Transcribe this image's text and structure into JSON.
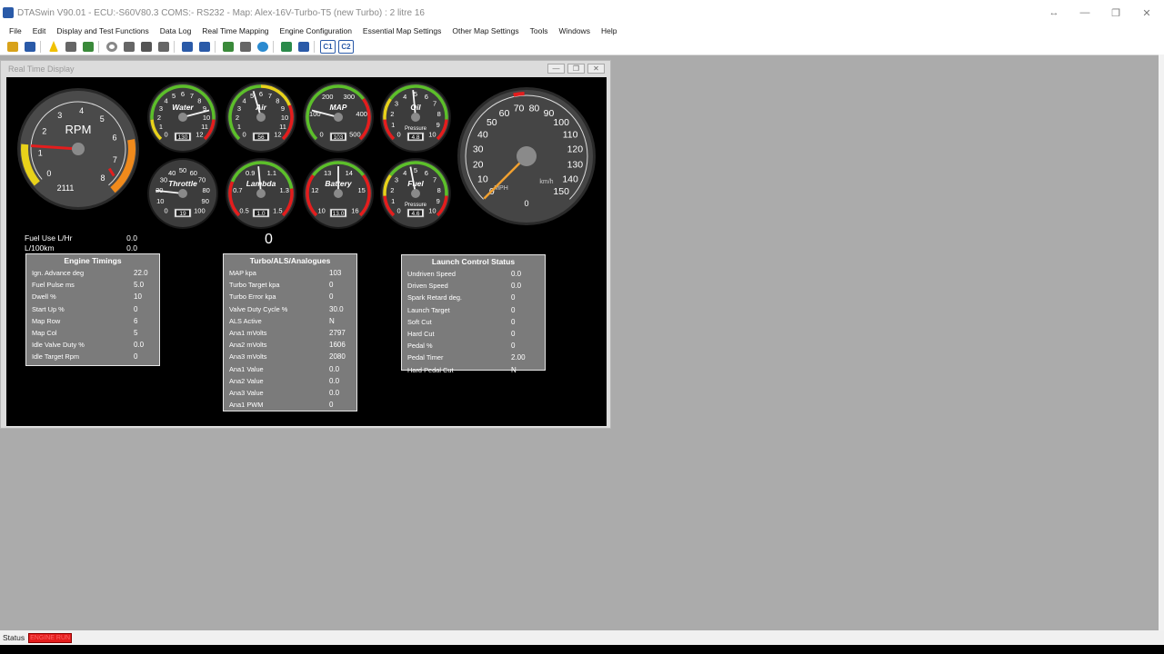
{
  "window": {
    "title": "DTASwin V90.01 - ECU:-S60V80.3 COMS:- RS232 - Map: Alex-16V-Turbo-T5 (new Turbo) : 2 litre 16",
    "resize_glyph": "↔",
    "min_glyph": "—",
    "max_glyph": "❐",
    "close_glyph": "✕"
  },
  "menu": [
    "File",
    "Edit",
    "Display and Test Functions",
    "Data Log",
    "Real Time Mapping",
    "Engine Configuration",
    "Essential Map Settings",
    "Other Map Settings",
    "Tools",
    "Windows",
    "Help"
  ],
  "toolbar": {
    "icons": [
      "open-folder-icon",
      "save-icon",
      "lightning-icon",
      "lock-icon",
      "chip-icon",
      "gear-icon",
      "pencil-icon",
      "wrench-icon",
      "turbo-icon",
      "ignition-icon",
      "s-icon",
      "chart-icon",
      "tools-icon",
      "globe-icon",
      "arrow-panel-icon",
      "grid-icon",
      "c1-icon",
      "c2-icon"
    ],
    "c1": "C1",
    "c2": "C2"
  },
  "child": {
    "title": "Real Time Display",
    "min": "—",
    "max": "❐",
    "close": "✕"
  },
  "gauges": {
    "rpm": {
      "label": "RPM",
      "value": "2111",
      "ticks": [
        "0",
        "1",
        "2",
        "3",
        "4",
        "5",
        "6",
        "7",
        "8"
      ],
      "reading": 1.3
    },
    "water": {
      "label": "Water",
      "value": "130",
      "ticks": [
        "0",
        "1",
        "2",
        "3",
        "4",
        "5",
        "6",
        "7",
        "8",
        "9",
        "10",
        "11",
        "12"
      ]
    },
    "air": {
      "label": "Air",
      "value": "56",
      "ticks": [
        "0",
        "1",
        "2",
        "3",
        "4",
        "5",
        "6",
        "7",
        "8",
        "9",
        "10",
        "11",
        "12"
      ]
    },
    "map": {
      "label": "MAP",
      "value": "103",
      "ticks": [
        "0",
        "100",
        "200",
        "300",
        "400",
        "500"
      ]
    },
    "oil": {
      "label": "Oil",
      "sub": "Pressure",
      "value": "4.8",
      "ticks": [
        "0",
        "1",
        "2",
        "3",
        "4",
        "5",
        "6",
        "7",
        "8",
        "9",
        "10"
      ]
    },
    "throttle": {
      "label": "Throttle",
      "value": "19",
      "ticks": [
        "0",
        "10",
        "20",
        "30",
        "40",
        "50",
        "60",
        "70",
        "80",
        "90",
        "100"
      ]
    },
    "lambda": {
      "label": "Lambda",
      "value": "1.0",
      "ticks": [
        "0.5",
        "0.7",
        "0.9",
        "1.1",
        "1.3",
        "1.5"
      ]
    },
    "battery": {
      "label": "Battery",
      "value": "13.0",
      "ticks": [
        "10",
        "12",
        "13",
        "14",
        "15",
        "16"
      ]
    },
    "fuel": {
      "label": "Fuel",
      "sub": "Pressure",
      "value": "4.6",
      "ticks": [
        "0",
        "1",
        "2",
        "3",
        "4",
        "5",
        "6",
        "7",
        "8",
        "9",
        "10"
      ]
    },
    "speed": {
      "label_mph": "MPH",
      "label_kmh": "km/h",
      "value": "0",
      "ticks": [
        "0",
        "10",
        "20",
        "30",
        "40",
        "50",
        "60",
        "70",
        "80",
        "90",
        "100",
        "110",
        "120",
        "130",
        "140",
        "150"
      ]
    }
  },
  "fuel_use": [
    {
      "label": "Fuel Use L/Hr",
      "value": "0.0"
    },
    {
      "label": "L/100km",
      "value": "0.0"
    }
  ],
  "center_value": "0",
  "engine_timings": {
    "title": "Engine Timings",
    "rows": [
      {
        "label": "Ign. Advance deg",
        "value": "22.0"
      },
      {
        "label": "Fuel Pulse ms",
        "value": "5.0"
      },
      {
        "label": "Dwell %",
        "value": "10"
      },
      {
        "label": "Start Up %",
        "value": "0"
      },
      {
        "label": "Map Row",
        "value": "6"
      },
      {
        "label": "Map Col",
        "value": "5"
      },
      {
        "label": "Idle Valve Duty %",
        "value": "0.0"
      },
      {
        "label": "Idle Target Rpm",
        "value": "0"
      }
    ]
  },
  "turbo": {
    "title": "Turbo/ALS/Analogues",
    "rows": [
      {
        "label": "MAP kpa",
        "value": "103"
      },
      {
        "label": "Turbo Target kpa",
        "value": "0"
      },
      {
        "label": "Turbo Error kpa",
        "value": "0"
      },
      {
        "label": "Valve Duty Cycle %",
        "value": "30.0"
      },
      {
        "label": "ALS Active",
        "value": "N"
      },
      {
        "label": "Ana1 mVolts",
        "value": "2797"
      },
      {
        "label": "Ana2 mVolts",
        "value": "1606"
      },
      {
        "label": "Ana3 mVolts",
        "value": "2080"
      },
      {
        "label": "Ana1 Value",
        "value": "0.0"
      },
      {
        "label": "Ana2 Value",
        "value": "0.0"
      },
      {
        "label": "Ana3 Value",
        "value": "0.0"
      },
      {
        "label": "Ana1 PWM",
        "value": "0"
      }
    ]
  },
  "launch": {
    "title": "Launch Control Status",
    "rows": [
      {
        "label": "Undriven Speed",
        "value": "0.0"
      },
      {
        "label": "Driven Speed",
        "value": "0.0"
      },
      {
        "label": "Spark Retard deg.",
        "value": "0"
      },
      {
        "label": "Launch Target",
        "value": "0"
      },
      {
        "label": "Soft Cut",
        "value": "0"
      },
      {
        "label": "Hard Cut",
        "value": "0"
      },
      {
        "label": "Pedal %",
        "value": "0"
      },
      {
        "label": "Pedal Timer",
        "value": "2.00"
      },
      {
        "label": "Hard Pedal Cut",
        "value": "N"
      }
    ]
  },
  "status": {
    "label": "Status",
    "badge": "ENGINE RUN"
  },
  "colors": {
    "accent_red": "#e41d1d",
    "gauge_yellow": "#e8d21a",
    "gauge_green": "#5cbf2a",
    "gauge_orange": "#f08a1c"
  }
}
